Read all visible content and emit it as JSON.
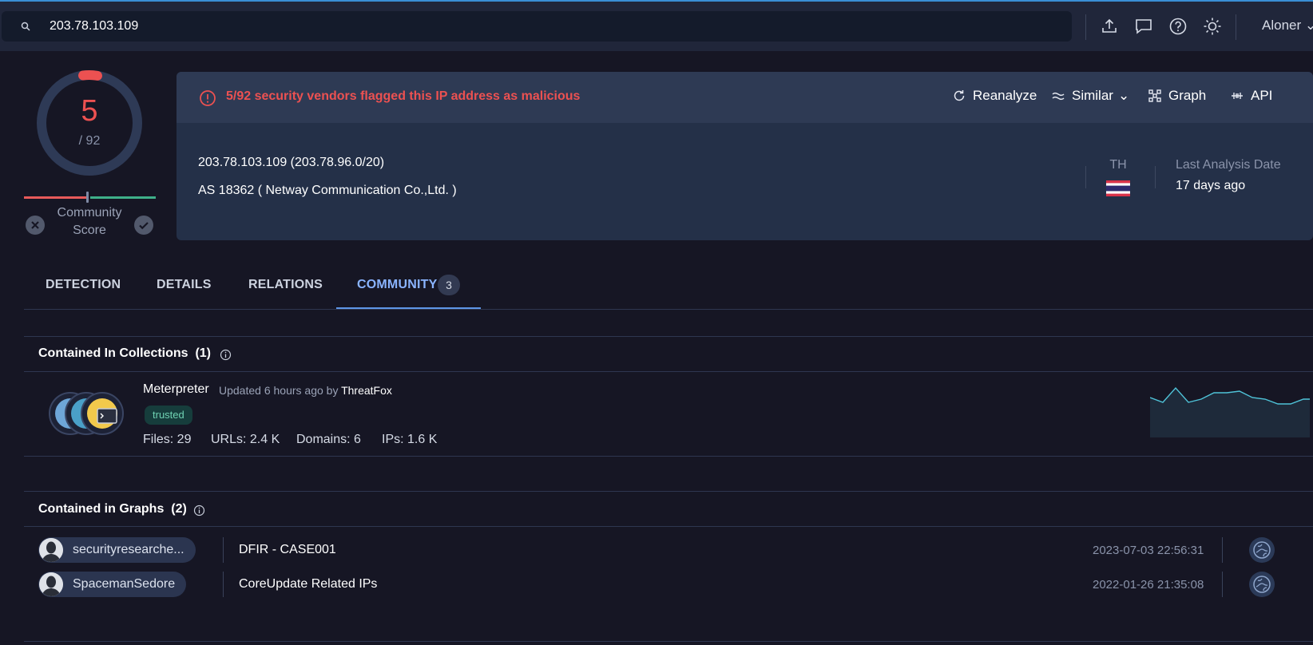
{
  "search": {
    "value": "203.78.103.109"
  },
  "header": {
    "icons": [
      "upload-icon",
      "chat-icon",
      "help-icon",
      "theme-icon"
    ],
    "user": "Aloner"
  },
  "score": {
    "detections": "5",
    "total": "/ 92",
    "community_label_1": "Community",
    "community_label_2": "Score"
  },
  "summary": {
    "alert": "5/92 security vendors flagged this IP address as malicious",
    "actions": {
      "reanalyze": "Reanalyze",
      "similar": "Similar",
      "graph": "Graph",
      "api": "API"
    },
    "ip_line": "203.78.103.109  (203.78.96.0/20)",
    "as_line": "AS 18362  ( Netway Communication Co.,Ltd. )",
    "country": "TH",
    "last_analysis_label": "Last Analysis Date",
    "last_analysis_value": "17 days ago"
  },
  "tabs": {
    "detection": "DETECTION",
    "details": "DETAILS",
    "relations": "RELATIONS",
    "community": "COMMUNITY",
    "community_count": "3"
  },
  "collections": {
    "title": "Contained In Collections",
    "count": "(1)",
    "item": {
      "name": "Meterpreter",
      "updated": "Updated 6 hours ago by",
      "by": "ThreatFox",
      "badge": "trusted",
      "files": "Files: 29",
      "urls": "URLs: 2.4 K",
      "domains": "Domains: 6",
      "ips": "IPs: 1.6 K"
    }
  },
  "graphs": {
    "title": "Contained in Graphs",
    "count": "(2)",
    "rows": [
      {
        "owner": "securityresearche...",
        "name": "DFIR - CASE001",
        "date": "2023-07-03 22:56:31"
      },
      {
        "owner": "SpacemanSedore",
        "name": "CoreUpdate Related IPs",
        "date": "2022-01-26 21:35:08"
      }
    ]
  },
  "colors": {
    "malicious": "#ec5151",
    "accent": "#8ab4ff",
    "trusted": "#6fd2b3"
  }
}
